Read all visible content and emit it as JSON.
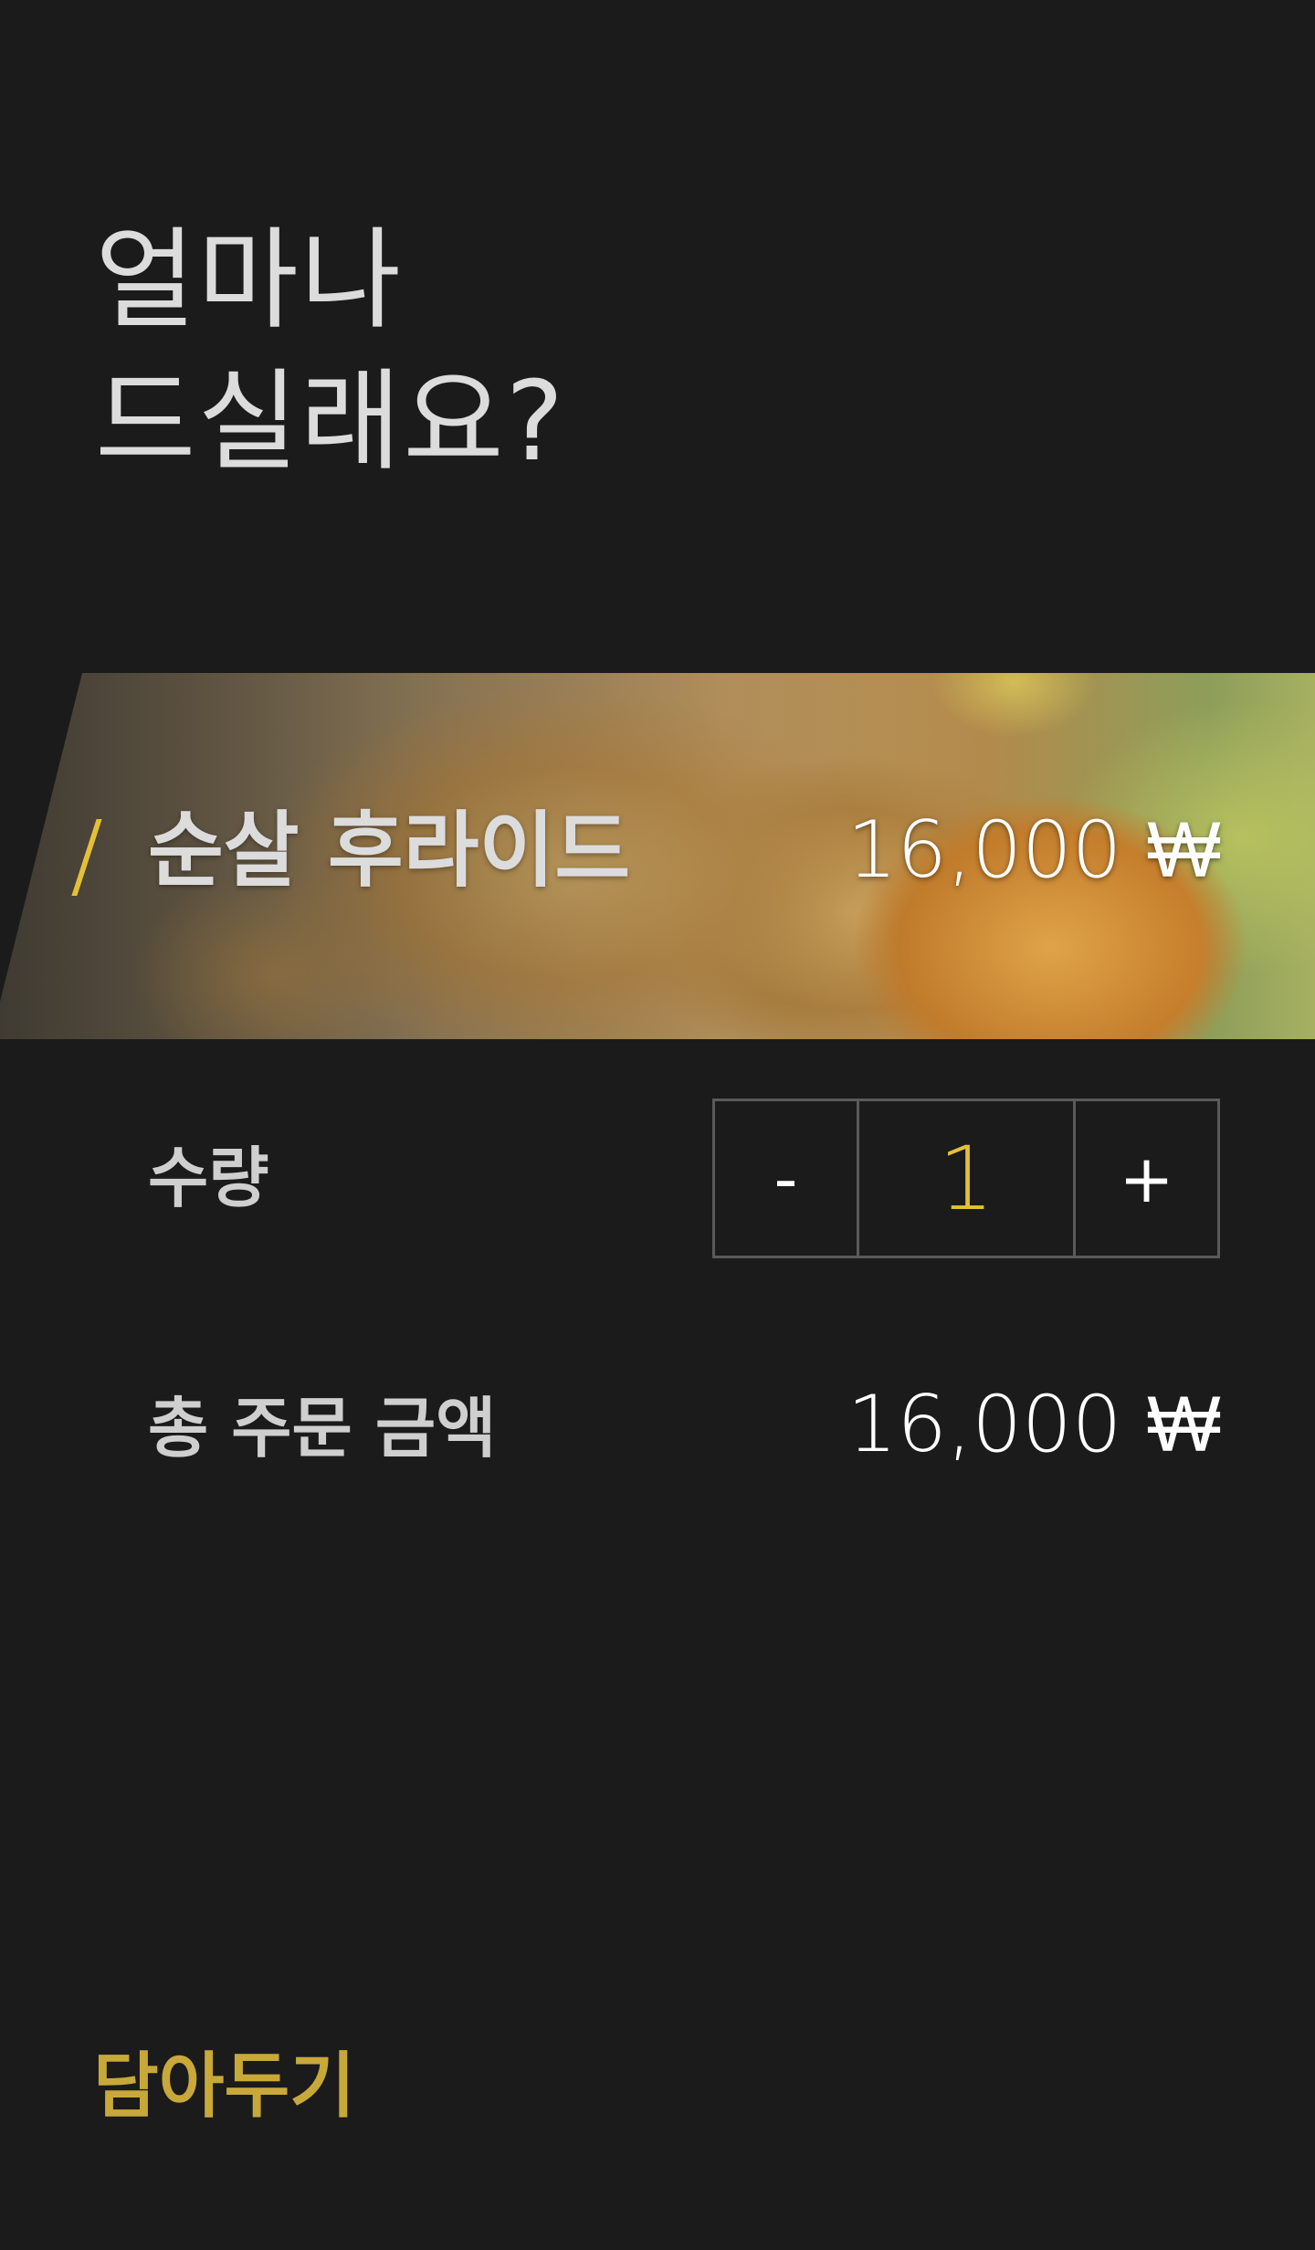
{
  "headline": {
    "line1": "얼마나",
    "line2": "드실래요?"
  },
  "product": {
    "name": "순살 후라이드",
    "price": "16,000 ₩",
    "image_description_icon": "fried-chicken-photo"
  },
  "quantity": {
    "label": "수량",
    "decrement_label": "-",
    "increment_label": "+",
    "value": "1"
  },
  "total": {
    "label": "총 주문 금액",
    "amount": "16,000 ₩"
  },
  "cart": {
    "label": "담아두기"
  },
  "colors": {
    "background": "#1b1b1b",
    "accent": "#e3c038",
    "cart_accent": "#c9a83a",
    "stepper_border": "#5a5a5a"
  }
}
